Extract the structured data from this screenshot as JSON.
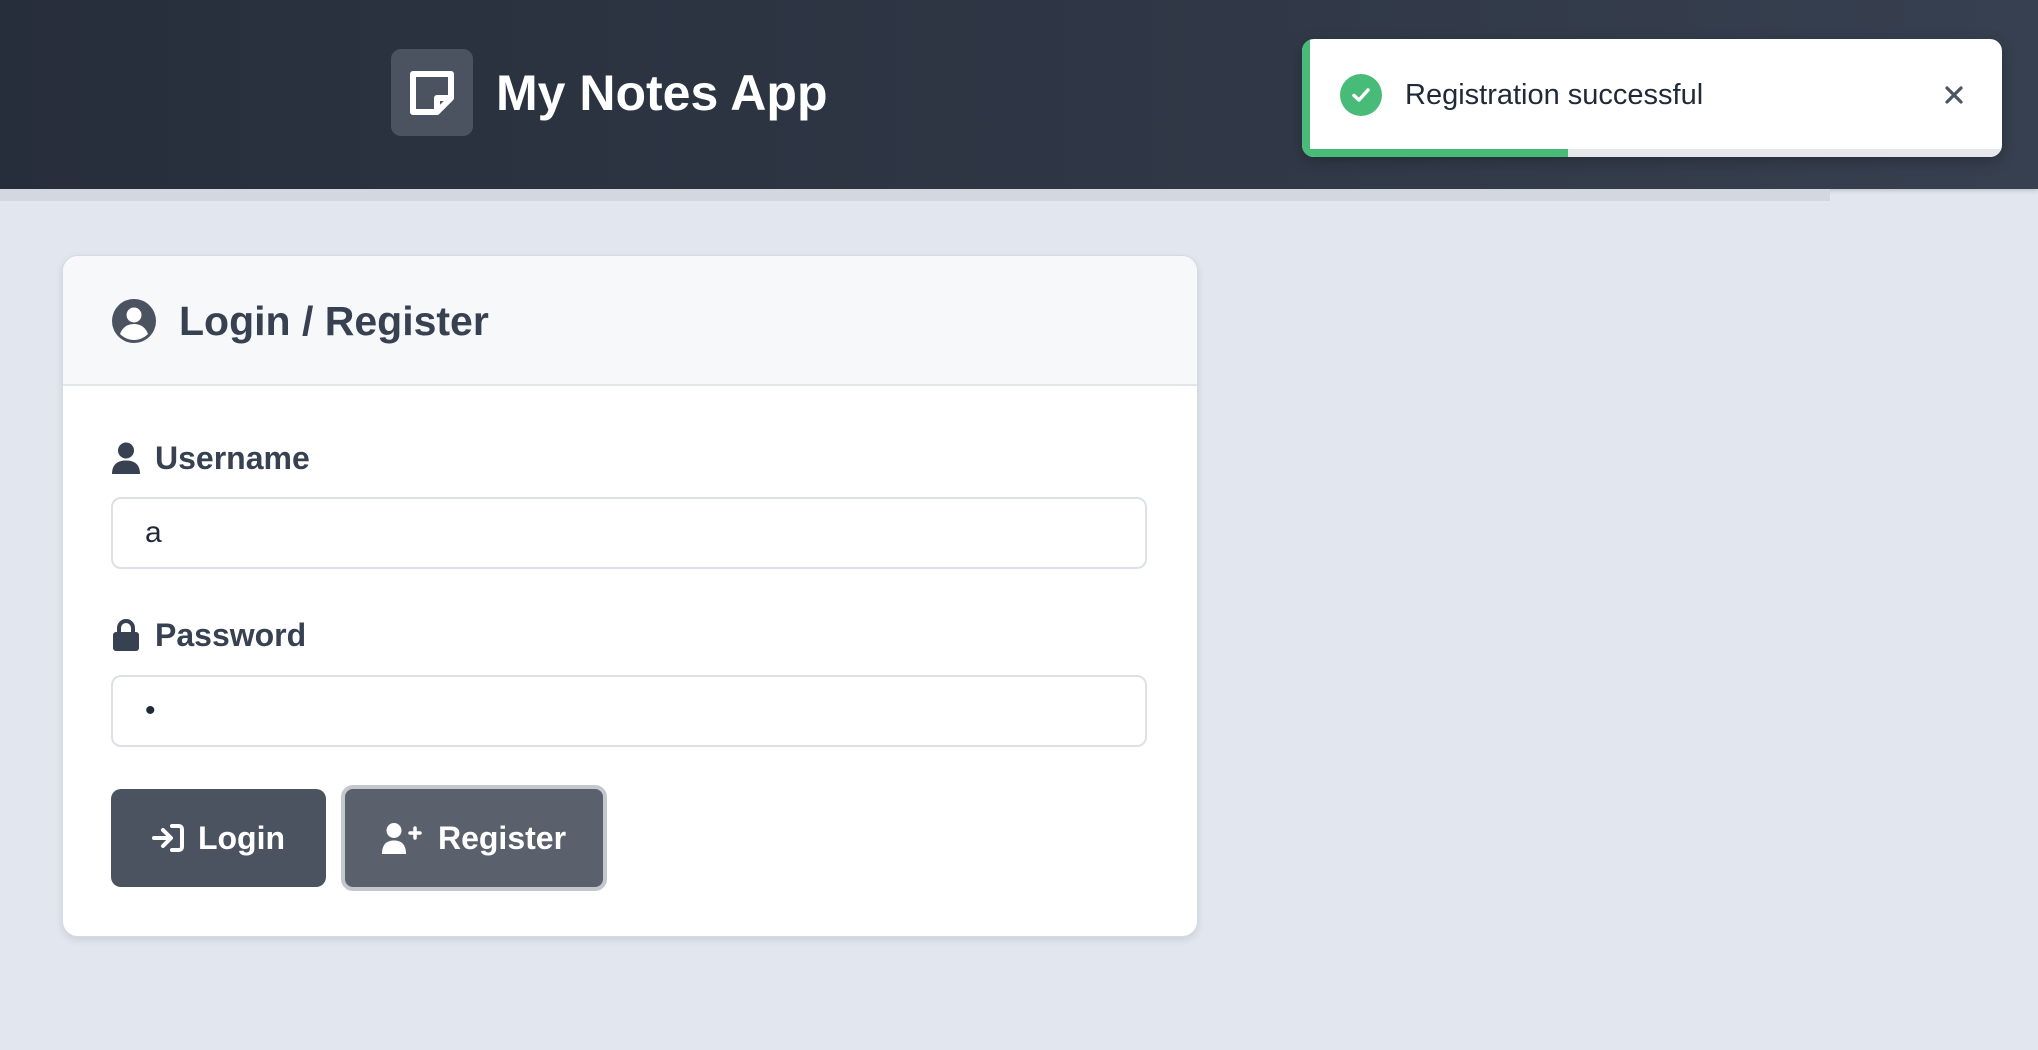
{
  "header": {
    "app_title": "My Notes App",
    "logo_icon": "note-icon"
  },
  "toast": {
    "message": "Registration successful",
    "status_icon": "check-circle-icon",
    "close_icon": "close-icon",
    "status_color": "#48bb78",
    "progress_remaining": 0.38
  },
  "login_card": {
    "title": "Login / Register",
    "title_icon": "user-circle-icon",
    "username": {
      "label": "Username",
      "icon": "user-icon",
      "value": "a"
    },
    "password": {
      "label": "Password",
      "icon": "lock-icon",
      "value": "a"
    },
    "login_button": {
      "label": "Login",
      "icon": "sign-in-icon"
    },
    "register_button": {
      "label": "Register",
      "icon": "user-plus-icon"
    }
  },
  "colors": {
    "header_bg": "#2b3240",
    "page_bg": "#e2e7ef",
    "primary_button": "#4b5361",
    "success": "#48bb78"
  }
}
